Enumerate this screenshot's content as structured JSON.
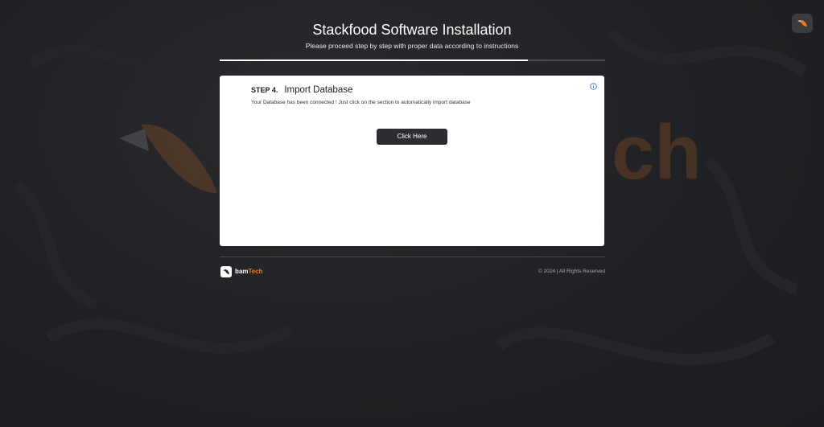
{
  "header": {
    "title": "Stackfood Software Installation",
    "subtitle": "Please proceed step by step with proper data according to instructions"
  },
  "progress": {
    "fraction": 0.8
  },
  "step": {
    "label": "STEP 4.",
    "title": "Import Database",
    "description": "Your Database has been connected ! Just click on the section to automatically import database"
  },
  "action": {
    "button_label": "Click Here"
  },
  "footer": {
    "brand_prefix": "bam",
    "brand_accent": "Tech",
    "copyright": "© 2024 | All Rights Reserved"
  },
  "colors": {
    "background": "#202124",
    "accent": "#f07a22",
    "card": "#ffffff",
    "button": "#2c2d30"
  },
  "icons": {
    "corner": "bird-logo-icon",
    "info": "info-icon",
    "footer": "bird-logo-icon"
  }
}
